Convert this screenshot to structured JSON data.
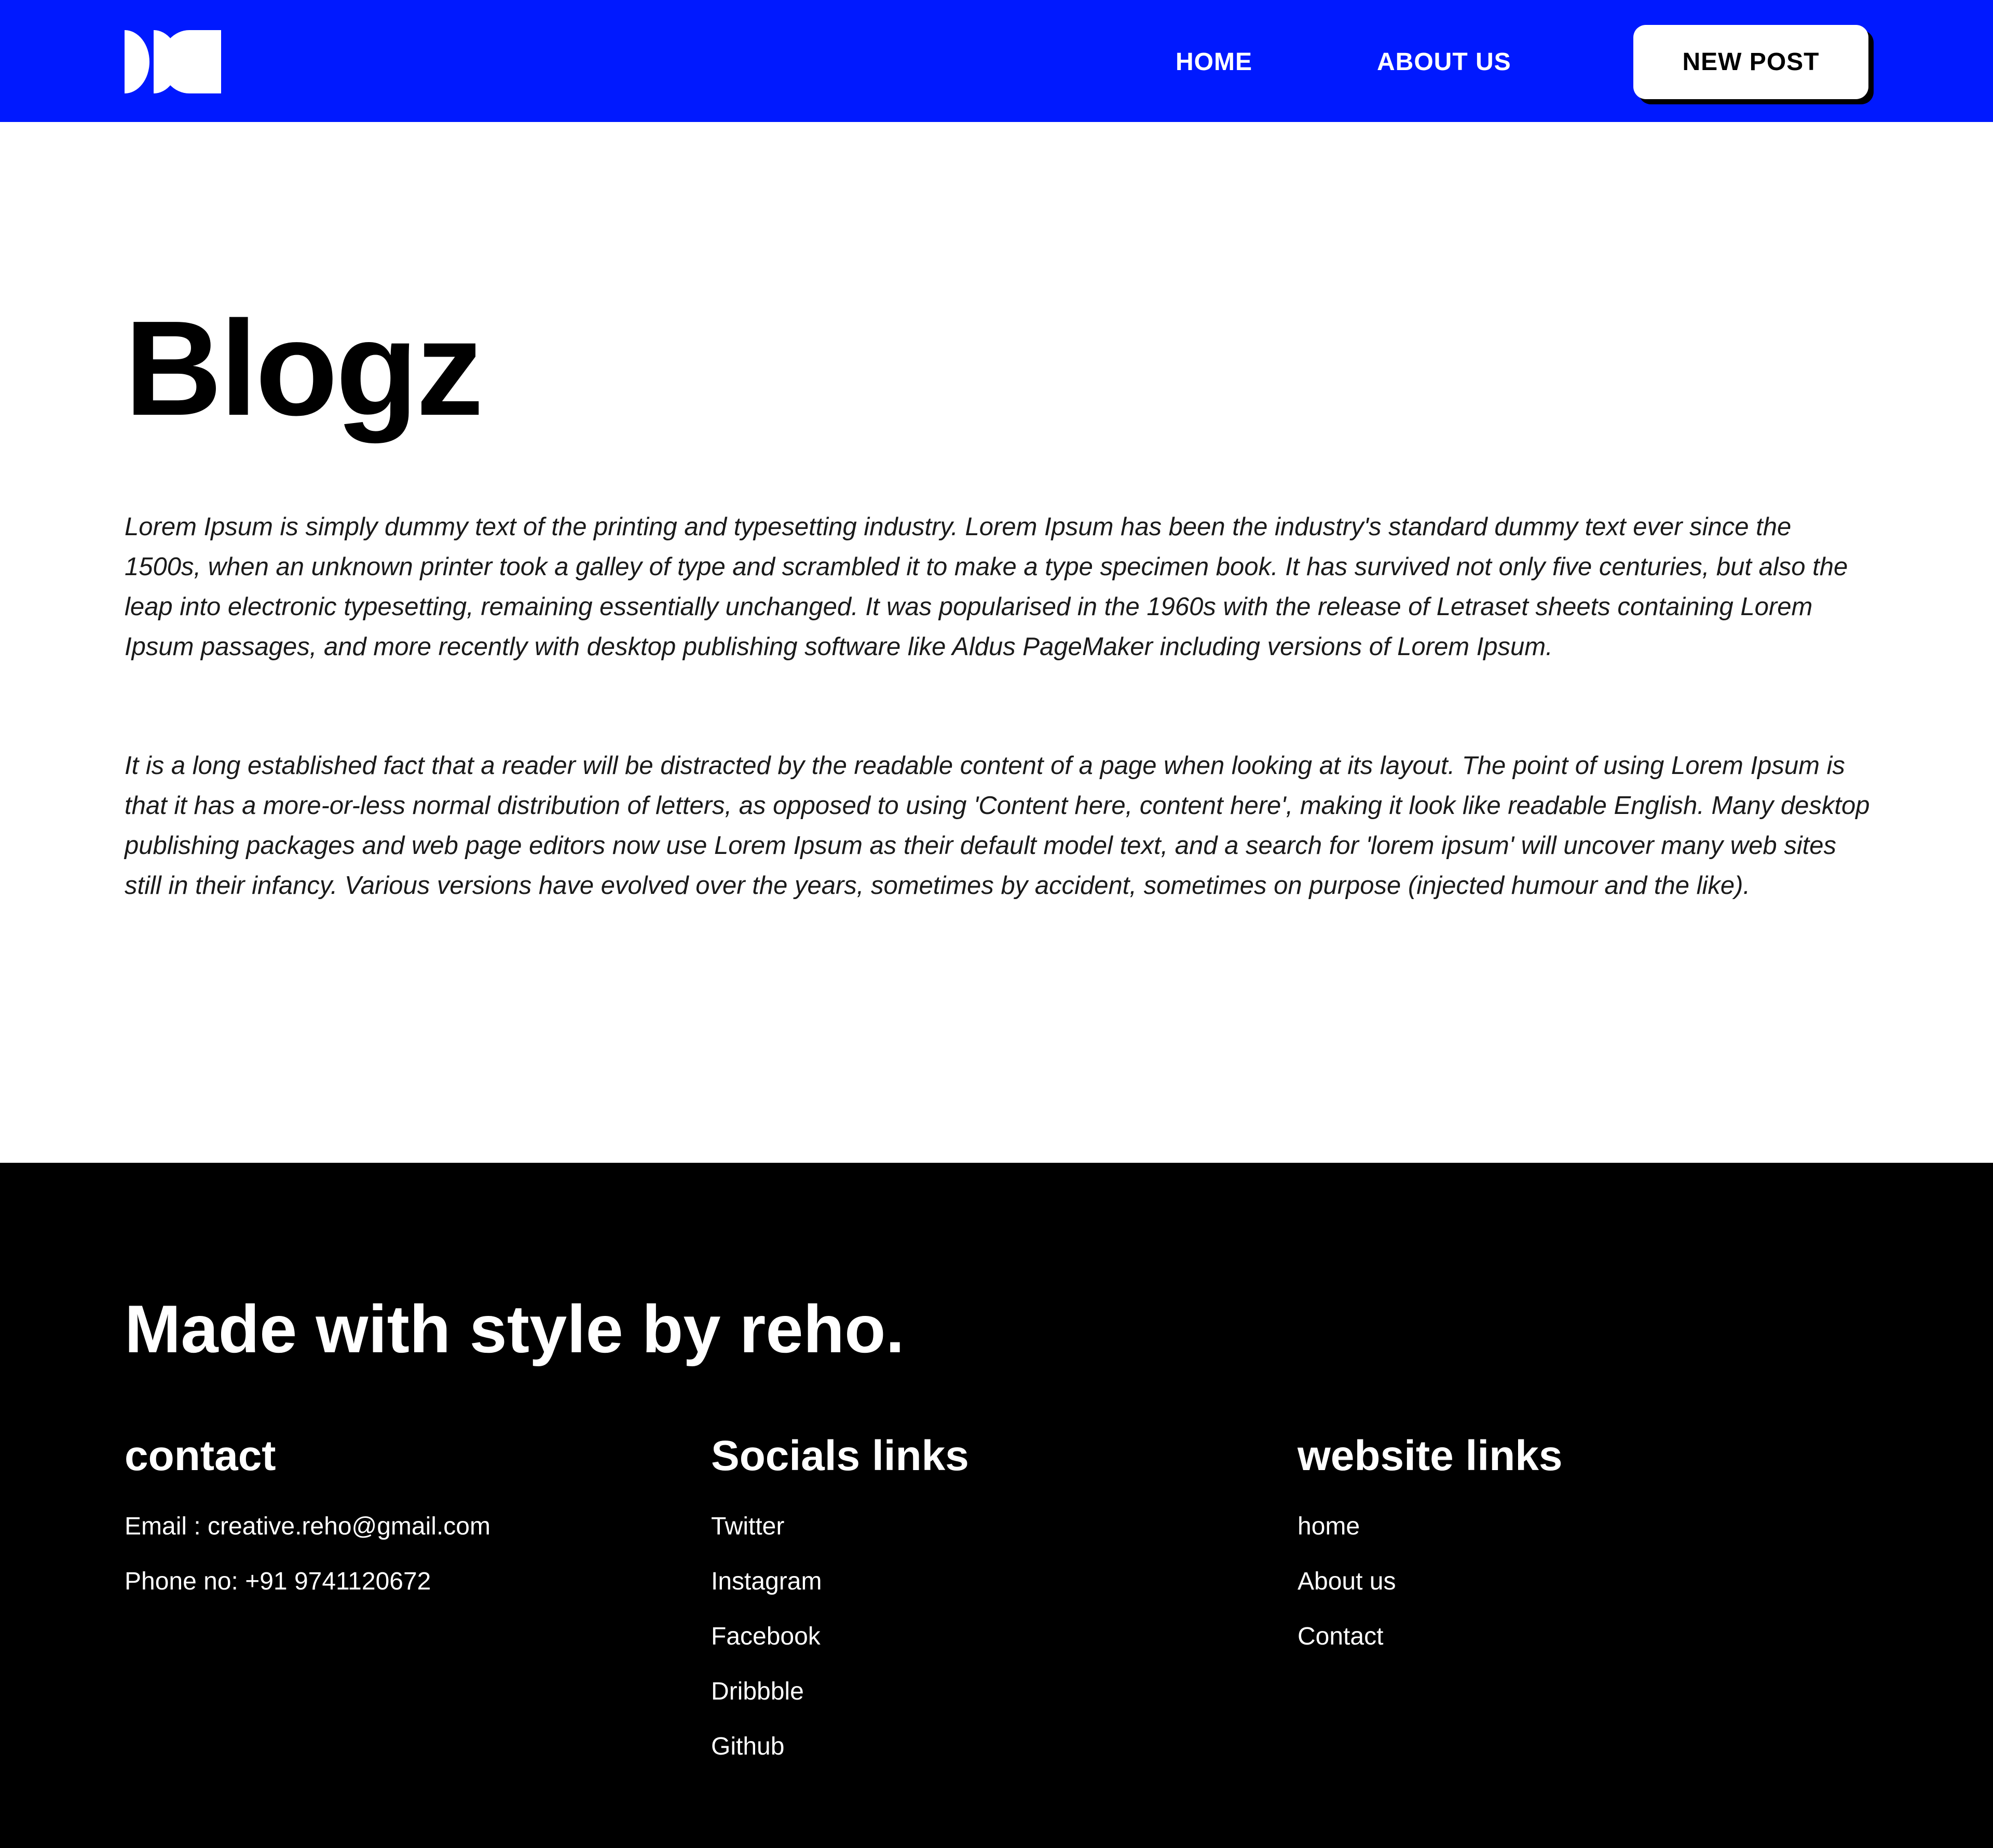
{
  "colors": {
    "header_bg": "#0019ff",
    "footer_bg": "#000000",
    "button_bg": "#ffffff",
    "text_dark": "#000000",
    "text_light": "#ffffff"
  },
  "header": {
    "logo_icon": "brand-logo-icon",
    "nav": {
      "home": "HOME",
      "about": "ABOUT US"
    },
    "new_post_label": "NEW POST"
  },
  "main": {
    "title": "Blogz",
    "paragraphs": [
      "Lorem Ipsum is simply dummy text of the printing and typesetting industry. Lorem Ipsum has been the industry's standard dummy text ever since the 1500s, when an unknown printer took a galley of type and scrambled it to make a type specimen book. It has survived not only five centuries, but also the leap into electronic typesetting, remaining essentially unchanged. It was popularised in the 1960s with the release of Letraset sheets containing Lorem Ipsum passages, and more recently with desktop publishing software like Aldus PageMaker including versions of Lorem Ipsum.",
      "It is a long established fact that a reader will be distracted by the readable content of a page when looking at its layout. The point of using Lorem Ipsum is that it has a more-or-less normal distribution of letters, as opposed to using 'Content here, content here', making it look like readable English. Many desktop publishing packages and web page editors now use Lorem Ipsum as their default model text, and a search for 'lorem ipsum' will uncover many web sites still in their infancy. Various versions have evolved over the years, sometimes by accident, sometimes on purpose (injected humour and the like)."
    ]
  },
  "footer": {
    "tagline": "Made with style by reho.",
    "contact": {
      "heading": "contact",
      "items": [
        "Email : creative.reho@gmail.com",
        "Phone no: +91 9741120672"
      ]
    },
    "socials": {
      "heading": "Socials links",
      "items": [
        "Twitter",
        "Instagram",
        "Facebook",
        "Dribbble",
        "Github"
      ]
    },
    "website": {
      "heading": "website links",
      "items": [
        "home",
        "About us",
        "Contact"
      ]
    }
  }
}
